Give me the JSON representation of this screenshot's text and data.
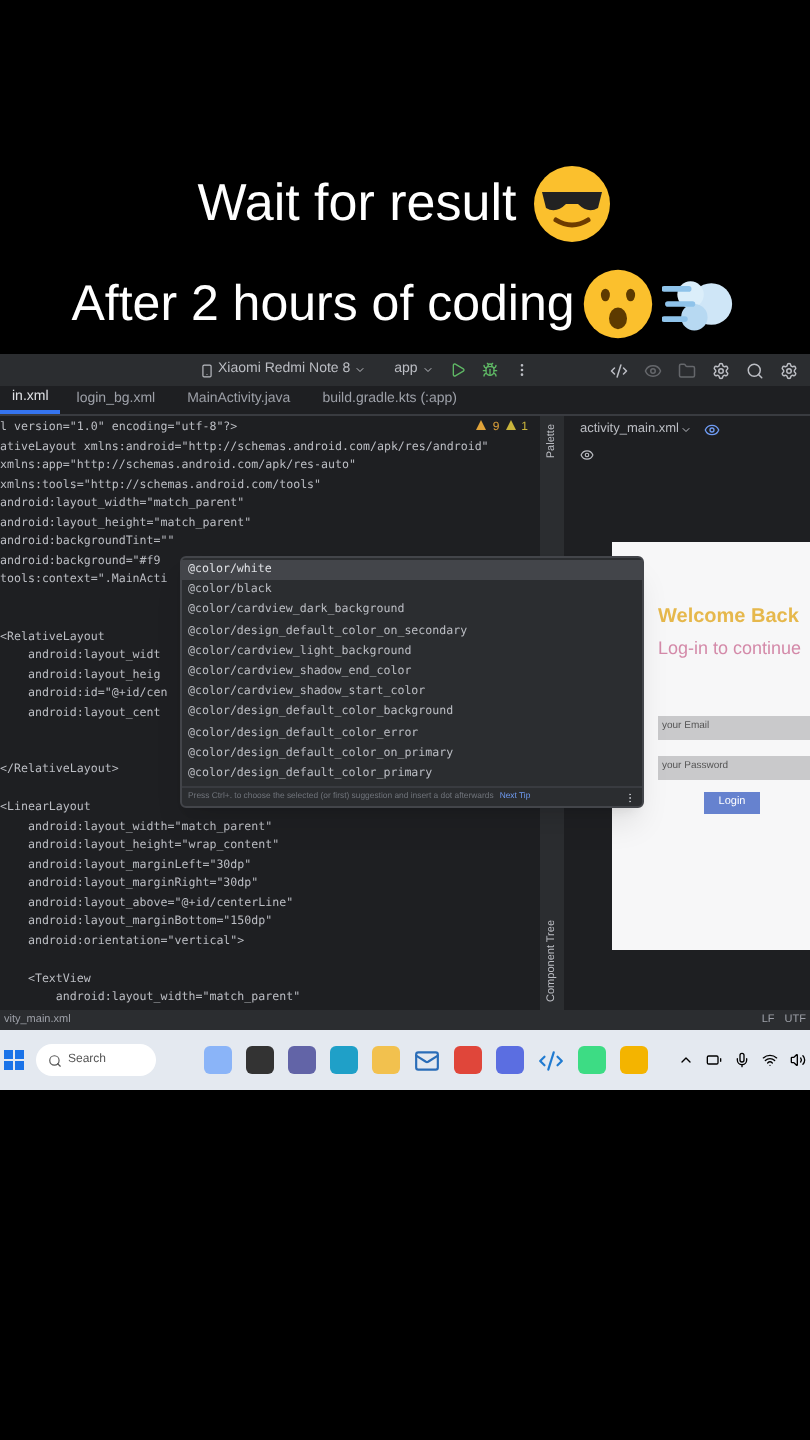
{
  "captions": [
    "Wait for result",
    "After 2 hours of coding"
  ],
  "toolbar": {
    "device": "Xiaomi Redmi Note 8",
    "config": "app"
  },
  "tabs": [
    {
      "label": "in.xml",
      "selected": true
    },
    {
      "label": "login_bg.xml",
      "selected": false
    },
    {
      "label": "MainActivity.java",
      "selected": false
    },
    {
      "label": "build.gradle.kts (:app)",
      "selected": false
    }
  ],
  "editor": {
    "warnings": "9",
    "weak_warnings": "1",
    "lines": [
      {
        "kind": "code",
        "text": "l version=\"1.0\" encoding=\"utf-8\"?>"
      },
      {
        "kind": "code",
        "text": "ativeLayout xmlns:android=\"http://schemas.android.com/apk/res/android\""
      },
      {
        "kind": "code",
        "text": "xmlns:app=\"http://schemas.android.com/apk/res-auto\""
      },
      {
        "kind": "code",
        "text": "xmlns:tools=\"http://schemas.android.com/tools\""
      },
      {
        "kind": "code",
        "text": "android:layout_width=\"match_parent\""
      },
      {
        "kind": "code",
        "text": "android:layout_height=\"match_parent\""
      },
      {
        "kind": "code",
        "text": "android:backgroundTint=\"\""
      },
      {
        "kind": "code",
        "text": "android:background=\"#f9"
      },
      {
        "kind": "code",
        "text": "tools:context=\".MainActi"
      },
      {
        "kind": "blank"
      },
      {
        "kind": "blank"
      },
      {
        "kind": "code",
        "text": "<RelativeLayout"
      },
      {
        "kind": "code",
        "text": "    android:layout_widt"
      },
      {
        "kind": "code",
        "text": "    android:layout_heig"
      },
      {
        "kind": "code",
        "text": "    android:id=\"@+id/cen"
      },
      {
        "kind": "code",
        "text": "    android:layout_cent"
      },
      {
        "kind": "blank"
      },
      {
        "kind": "blank"
      },
      {
        "kind": "code",
        "text": "</RelativeLayout>"
      },
      {
        "kind": "blank"
      },
      {
        "kind": "code",
        "text": "<LinearLayout"
      },
      {
        "kind": "code",
        "text": "    android:layout_width=\"match_parent\""
      },
      {
        "kind": "code",
        "text": "    android:layout_height=\"wrap_content\""
      },
      {
        "kind": "code",
        "text": "    android:layout_marginLeft=\"30dp\""
      },
      {
        "kind": "code",
        "text": "    android:layout_marginRight=\"30dp\""
      },
      {
        "kind": "code",
        "text": "    android:layout_above=\"@+id/centerLine\""
      },
      {
        "kind": "code",
        "text": "    android:layout_marginBottom=\"150dp\""
      },
      {
        "kind": "code",
        "text": "    android:orientation=\"vertical\">"
      },
      {
        "kind": "blank"
      },
      {
        "kind": "code",
        "text": "    <TextView"
      },
      {
        "kind": "code",
        "text": "        android:layout_width=\"match_parent\""
      }
    ]
  },
  "completion": {
    "items": [
      {
        "text": "@color/white",
        "selected": true
      },
      {
        "text": "@color/black",
        "selected": false
      },
      {
        "text": "@color/cardview_dark_background",
        "selected": false
      },
      {
        "text": "@color/design_default_color_on_secondary",
        "selected": false
      },
      {
        "text": "@color/cardview_light_background",
        "selected": false
      },
      {
        "text": "@color/cardview_shadow_end_color",
        "selected": false
      },
      {
        "text": "@color/cardview_shadow_start_color",
        "selected": false
      },
      {
        "text": "@color/design_default_color_background",
        "selected": false
      },
      {
        "text": "@color/design_default_color_error",
        "selected": false
      },
      {
        "text": "@color/design_default_color_on_primary",
        "selected": false
      },
      {
        "text": "@color/design_default_color_primary",
        "selected": false
      }
    ],
    "hint": "Press Ctrl+. to choose the selected (or first) suggestion and insert a dot afterwards",
    "next_tip": "Next Tip"
  },
  "side_tabs": [
    "Palette",
    "Component Tree"
  ],
  "design": {
    "file": "activity_main.xml",
    "title": "Welcome Back",
    "subtitle": "Log-in to continue",
    "email_placeholder": "your Email",
    "password_placeholder": "your Password",
    "button": "Login"
  },
  "status_bar": {
    "file": "vity_main.xml",
    "line_sep": "LF",
    "encoding": "UTF"
  },
  "taskbar": {
    "search_placeholder": "Search"
  }
}
